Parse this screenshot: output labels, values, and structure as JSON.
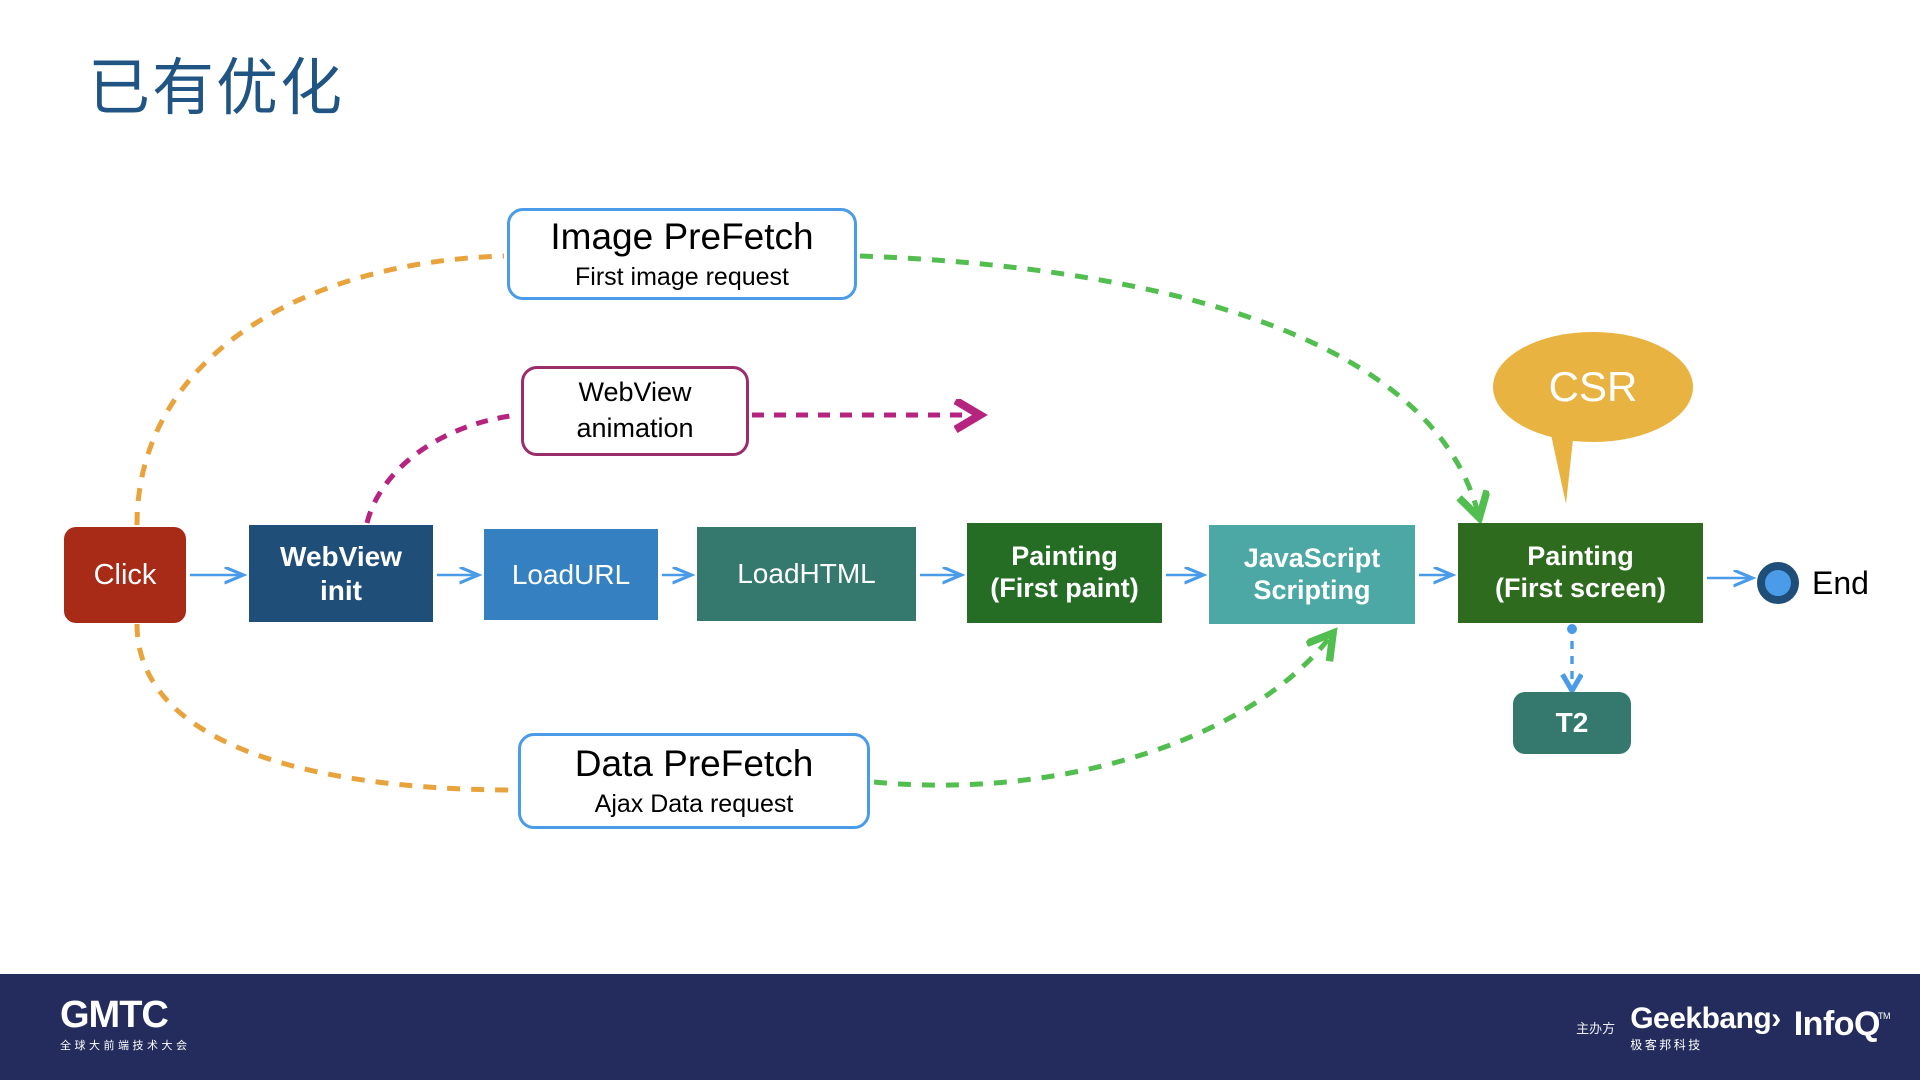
{
  "slide": {
    "title": "已有优化"
  },
  "flow": {
    "boxes": [
      {
        "id": "click",
        "label": "Click",
        "label2": "",
        "color": "#A82B17"
      },
      {
        "id": "webview",
        "label": "WebView",
        "label2": "init",
        "color": "#1F4E79"
      },
      {
        "id": "loadurl",
        "label": "LoadURL",
        "label2": "",
        "color": "#3480C0"
      },
      {
        "id": "loadhtml",
        "label": "LoadHTML",
        "label2": "",
        "color": "#35796E"
      },
      {
        "id": "firstpaint",
        "label": "Painting",
        "label2": "(First paint)",
        "color": "#256D25"
      },
      {
        "id": "jsscripting",
        "label": "JavaScript",
        "label2": "Scripting",
        "color": "#4BA8A4"
      },
      {
        "id": "firstscreen",
        "label": "Painting",
        "label2": "(First screen)",
        "color": "#2E6B1E"
      }
    ],
    "end_label": "End",
    "t2_label": "T2"
  },
  "callouts": {
    "image_prefetch": {
      "title": "Image PreFetch",
      "subtitle": "First image request",
      "border_color": "#4A9BE8"
    },
    "data_prefetch": {
      "title": "Data PreFetch",
      "subtitle": "Ajax Data request",
      "border_color": "#4A9BE8"
    },
    "webview_animation": {
      "title": "WebView",
      "subtitle": "animation",
      "border_color": "#9C2D6B"
    },
    "csr": {
      "label": "CSR",
      "color": "#E9B341"
    }
  },
  "connectors": {
    "arrow_color": "#4A9BE8",
    "prefetch_dash_color": "#E8A33D",
    "green_dash_color": "#52BE4F",
    "animation_dash_color": "#B5247E",
    "t2_dash_color": "#4A9BE8"
  },
  "footer": {
    "background": "#232C5C",
    "gmtc_wordmark": "GMTC",
    "gmtc_tagline": "全球大前端技术大会",
    "organizer_label": "主办方",
    "geekbang_wordmark": "Geekbang›",
    "geekbang_cn": "极客邦科技",
    "infoq_wordmark": "InfoQ",
    "infoq_tm": "TM"
  }
}
